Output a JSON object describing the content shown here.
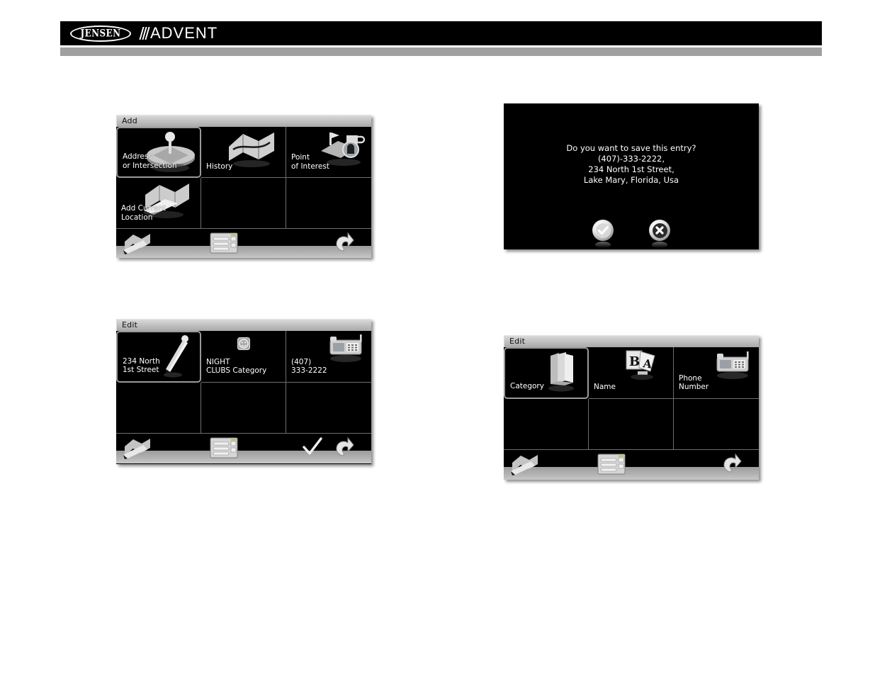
{
  "header": {
    "brand_primary": "JENSEN",
    "brand_secondary": "ADVENT",
    "bar_color": "#000000",
    "underbar_color": "#a0a0a0"
  },
  "panels": {
    "add_screen": {
      "title": "Add",
      "cells": [
        {
          "label": "Address\nor Intersection",
          "icon": "map-pin-icon",
          "selected": true
        },
        {
          "label": "History",
          "icon": "folded-map-icon",
          "selected": false
        },
        {
          "label": "Point\nof Interest",
          "icon": "poi-cup-fuel-icon",
          "selected": false
        },
        {
          "label": "Add Current\nLocation",
          "icon": "map-car-icon",
          "selected": false
        },
        {
          "label": "",
          "icon": "",
          "selected": false
        },
        {
          "label": "",
          "icon": "",
          "selected": false
        }
      ],
      "toolbar": [
        {
          "name": "map-pen-icon",
          "position": "left"
        },
        {
          "name": "menu-list-icon",
          "position": "center"
        },
        {
          "name": "back-arrow-icon",
          "position": "right"
        }
      ]
    },
    "save_dialog": {
      "message": "Do you want to save this entry?\n(407)-333-2222,\n234 North 1st Street,\nLake Mary, Florida, Usa",
      "confirm_label": "✔",
      "cancel_label": "✖"
    },
    "edit_values_screen": {
      "title": "Edit",
      "cells": [
        {
          "label": "234 North\n1st Street",
          "icon": "pencil-icon",
          "selected": true
        },
        {
          "label": "NIGHT\nCLUBS Category",
          "icon": "smiley-icon",
          "selected": false
        },
        {
          "label": "(407)\n333-2222",
          "icon": "telephone-icon",
          "selected": false
        },
        {
          "label": "",
          "icon": "",
          "selected": false
        },
        {
          "label": "",
          "icon": "",
          "selected": false
        },
        {
          "label": "",
          "icon": "",
          "selected": false
        }
      ],
      "toolbar": [
        {
          "name": "map-pen-icon",
          "position": "left"
        },
        {
          "name": "menu-list-icon",
          "position": "center"
        },
        {
          "name": "checkmark-icon",
          "position": "right-inner"
        },
        {
          "name": "back-arrow-icon",
          "position": "right"
        }
      ]
    },
    "edit_fields_screen": {
      "title": "Edit",
      "cells": [
        {
          "label": "Category",
          "icon": "folder-stack-icon",
          "selected": true
        },
        {
          "label": "Name",
          "icon": "letters-ba-icon",
          "selected": false
        },
        {
          "label": "Phone\nNumber",
          "icon": "telephone-icon",
          "selected": false
        },
        {
          "label": "",
          "icon": "",
          "selected": false
        },
        {
          "label": "",
          "icon": "",
          "selected": false
        },
        {
          "label": "",
          "icon": "",
          "selected": false
        }
      ],
      "toolbar": [
        {
          "name": "map-pen-icon",
          "position": "left"
        },
        {
          "name": "menu-list-icon",
          "position": "center"
        },
        {
          "name": "back-arrow-icon",
          "position": "right"
        }
      ]
    }
  }
}
